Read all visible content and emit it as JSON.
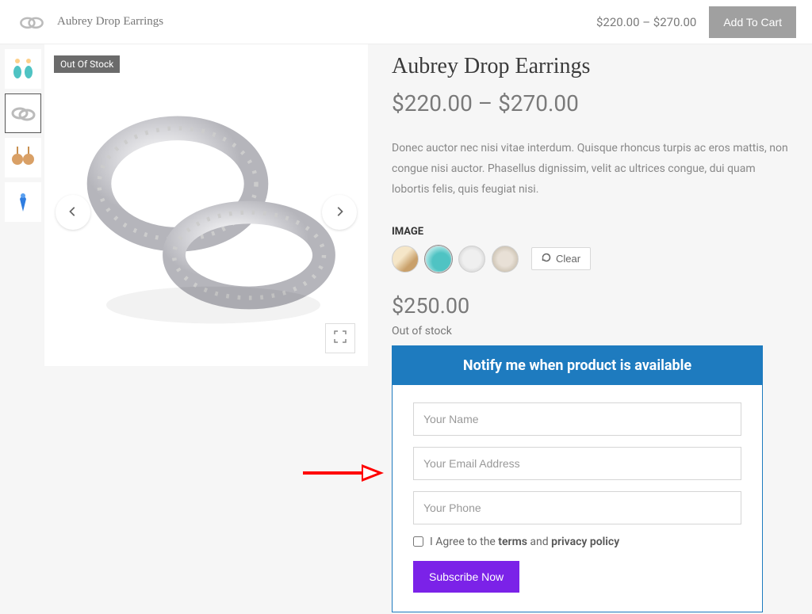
{
  "header": {
    "title": "Aubrey Drop Earrings",
    "price_range": "$220.00 – $270.00",
    "add_to_cart": "Add To Cart"
  },
  "gallery": {
    "out_of_stock_tag": "Out Of Stock"
  },
  "product": {
    "title": "Aubrey Drop Earrings",
    "price_range": "$220.00 – $270.00",
    "description": "Donec auctor nec nisi vitae interdum. Quisque rhoncus turpis ac eros mattis, non congue nisi auctor. Phasellus dignissim, velit ac ultrices congue, dui quam lobortis felis, quis feugiat nisi.",
    "variant_label": "IMAGE",
    "clear_label": "Clear",
    "price_single": "$250.00",
    "oos_text": "Out of stock"
  },
  "notify": {
    "header": "Notify me when product is available",
    "name_placeholder": "Your Name",
    "email_placeholder": "Your Email Address",
    "phone_placeholder": "Your Phone",
    "agree_prefix": "I Agree to the ",
    "terms": "terms",
    "agree_mid": " and ",
    "privacy": "privacy policy",
    "subscribe_label": "Subscribe Now"
  }
}
